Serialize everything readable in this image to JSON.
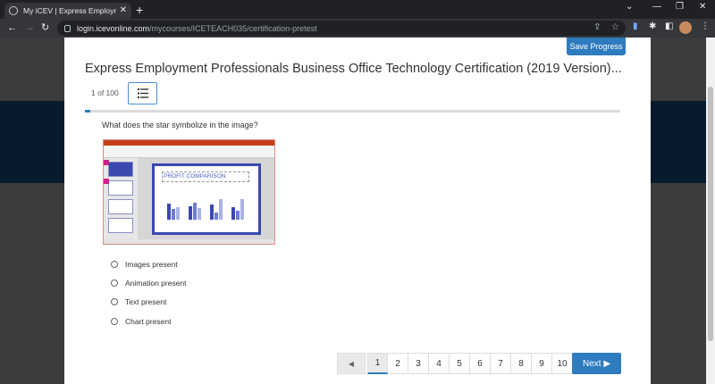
{
  "browser": {
    "tab_title": "My iCEV | Express Employment P",
    "tab_close": "✕",
    "new_tab": "+",
    "url_host": "login.icevonline.com",
    "url_path": "/mycourses/ICETEACH035/certification-pretest"
  },
  "header": {
    "save_label": "Save Progress",
    "title": "Express Employment Professionals Business Office Technology Certification (2019 Version)...",
    "counter": "1 of 100"
  },
  "progress": {
    "current": 1,
    "total": 100
  },
  "question": {
    "text": "What does the star symbolize in the image?",
    "image_slide_title": "PROFIT COMPARISON",
    "options": [
      {
        "label": "Images present"
      },
      {
        "label": "Animation present"
      },
      {
        "label": "Text present"
      },
      {
        "label": "Chart present"
      }
    ]
  },
  "pagination": {
    "prev": "◀",
    "pages": [
      "1",
      "2",
      "3",
      "4",
      "5",
      "6",
      "7",
      "8",
      "9",
      "10"
    ],
    "active": "1",
    "next_label": "Next ▶"
  },
  "colors": {
    "accent": "#2f7bbf",
    "band": "#071b2c"
  }
}
